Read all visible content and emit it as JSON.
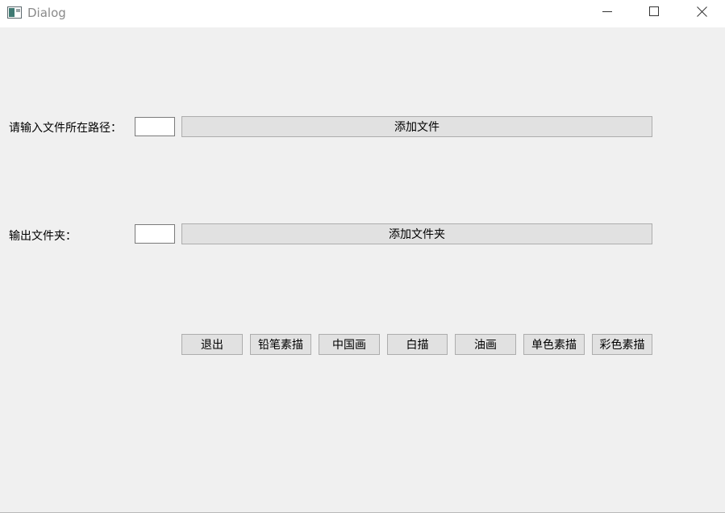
{
  "window": {
    "title": "Dialog"
  },
  "icons": {
    "app": "dialog-app-icon",
    "minimize": "minimize-icon",
    "maximize": "maximize-icon",
    "close": "close-icon"
  },
  "form": {
    "input_path_label": "请输入文件所在路径：",
    "input_path_value": "",
    "add_file_label": "添加文件",
    "output_folder_label": "输出文件夹：",
    "output_folder_value": "",
    "add_folder_label": "添加文件夹"
  },
  "actions": {
    "exit": "退出",
    "pencil_sketch": "铅笔素描",
    "chinese_painting": "中国画",
    "line_drawing": "白描",
    "oil_painting": "油画",
    "mono_sketch": "单色素描",
    "color_sketch": "彩色素描"
  },
  "colors": {
    "background": "#f0f0f0",
    "titlebar": "#ffffff",
    "button_face": "#e1e1e1",
    "button_border": "#adadad",
    "input_border": "#7a7a7a"
  }
}
